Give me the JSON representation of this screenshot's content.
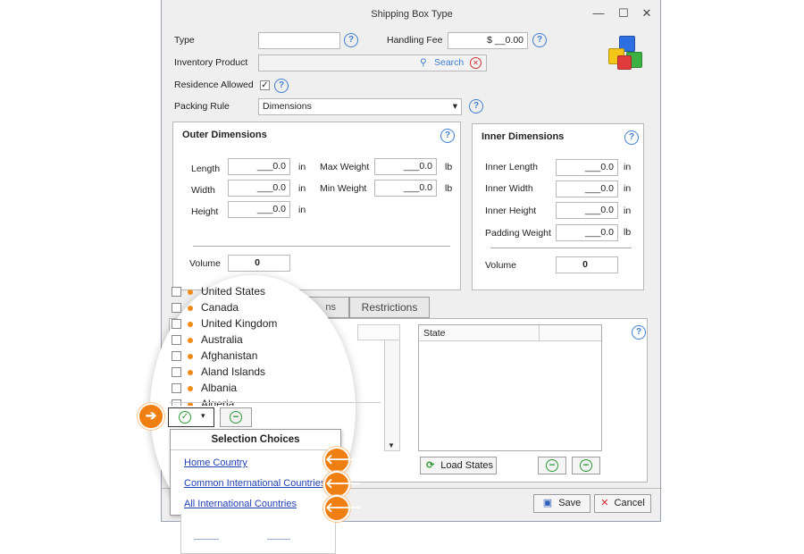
{
  "window": {
    "title": "Shipping Box Type",
    "controls": {
      "minimize": "—",
      "maximize": "☐",
      "close": "✕"
    }
  },
  "form": {
    "type_label": "Type",
    "type_value": "",
    "handling_fee_label": "Handling Fee",
    "handling_fee_value": "$ __0.00",
    "inventory_product_label": "Inventory Product",
    "search_label": "Search",
    "residence_allowed_label": "Residence Allowed",
    "residence_checkmark": "✓",
    "packing_rule_label": "Packing Rule",
    "packing_rule_value": "Dimensions"
  },
  "outer": {
    "title": "Outer Dimensions",
    "length_label": "Length",
    "length_value": "___0.0",
    "length_unit": "in",
    "width_label": "Width",
    "width_value": "___0.0",
    "width_unit": "in",
    "height_label": "Height",
    "height_value": "___0.0",
    "height_unit": "in",
    "max_weight_label": "Max Weight",
    "max_weight_value": "___0.0",
    "max_weight_unit": "lb",
    "min_weight_label": "Min Weight",
    "min_weight_value": "___0.0",
    "min_weight_unit": "lb",
    "volume_label": "Volume",
    "volume_value": "0"
  },
  "inner": {
    "title": "Inner Dimensions",
    "length_label": "Inner Length",
    "length_value": "___0.0",
    "length_unit": "in",
    "width_label": "Inner Width",
    "width_value": "___0.0",
    "width_unit": "in",
    "height_label": "Inner Height",
    "height_value": "___0.0",
    "height_unit": "in",
    "padding_label": "Padding Weight",
    "padding_value": "___0.0",
    "padding_unit": "lb",
    "volume_label": "Volume",
    "volume_value": "0"
  },
  "tabs": {
    "partial_tab": "ns",
    "restrictions_tab": "Restrictions"
  },
  "states_grid": {
    "column_header": "State",
    "load_states_label": "Load States"
  },
  "countries": [
    "United States",
    "Canada",
    "United Kingdom",
    "Australia",
    "Afghanistan",
    "Aland Islands",
    "Albania",
    "Algeria"
  ],
  "selection_menu": {
    "title": "Selection Choices",
    "items": [
      "Home Country",
      "Common International Countries",
      "All International Countries"
    ]
  },
  "footer": {
    "save_label": "Save",
    "cancel_label": "Cancel"
  },
  "icons": {
    "help_glyph": "?",
    "arrow_right": "➔",
    "arrow_left": "🡐",
    "check_glyph": "✓",
    "minus_glyph": "−",
    "dropdown_glyph": "▾",
    "clear_glyph": "✕",
    "search_glyph": "⚲"
  },
  "colors": {
    "accent_orange": "#f07f12",
    "link_blue": "#1f3fb5",
    "help_blue": "#3f7fd3",
    "green": "#2a9a37"
  }
}
